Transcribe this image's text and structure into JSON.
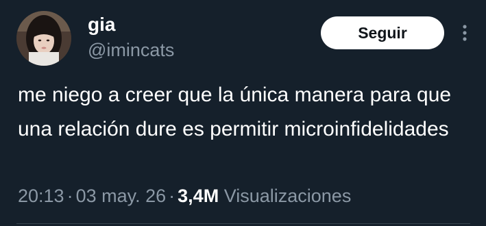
{
  "tweet": {
    "display_name": "gia",
    "handle": "@imincats",
    "follow_label": "Seguir",
    "text": "me niego a creer que la única manera para que una relación dure es permitir microinfidelidades",
    "time": "20:13",
    "separator": "·",
    "date": "03 may. 26",
    "views_count": "3,4M",
    "views_label": "Visualizaciones"
  },
  "icons": {
    "more": "more-vertical-icon"
  },
  "colors": {
    "background": "#15202b",
    "primary_text": "#ffffff",
    "secondary_text": "#8b98a5",
    "button_bg": "#ffffff",
    "button_text": "#0f1419"
  }
}
